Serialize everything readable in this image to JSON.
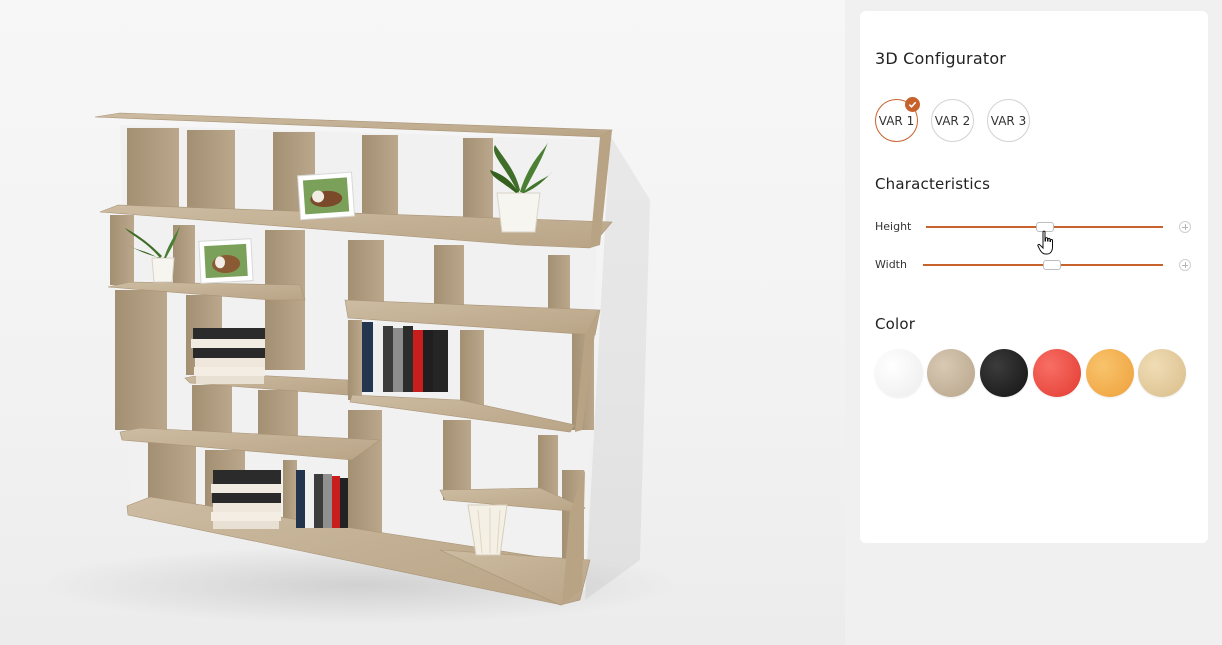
{
  "configurator": {
    "title": "3D Configurator",
    "variants": [
      {
        "label": "VAR 1",
        "selected": true
      },
      {
        "label": "VAR 2",
        "selected": false
      },
      {
        "label": "VAR 3",
        "selected": false
      }
    ],
    "characteristics_title": "Characteristics",
    "sliders": [
      {
        "label": "Height",
        "level": 0.47
      },
      {
        "label": "Width",
        "level": 0.54
      }
    ],
    "color_title": "Color",
    "colors": [
      {
        "name": "white",
        "hex": "#f4f4f4"
      },
      {
        "name": "beige",
        "hex": "#c9b8a0"
      },
      {
        "name": "black",
        "hex": "#1e1e1e"
      },
      {
        "name": "red",
        "hex": "#ee4a40"
      },
      {
        "name": "orange",
        "hex": "#f3aa48"
      },
      {
        "name": "light-wood",
        "hex": "#e6cd9f"
      }
    ],
    "accent_color": "#c8622c"
  },
  "scene": {
    "object": "bookshelf",
    "material_color": "#c7b49a"
  }
}
